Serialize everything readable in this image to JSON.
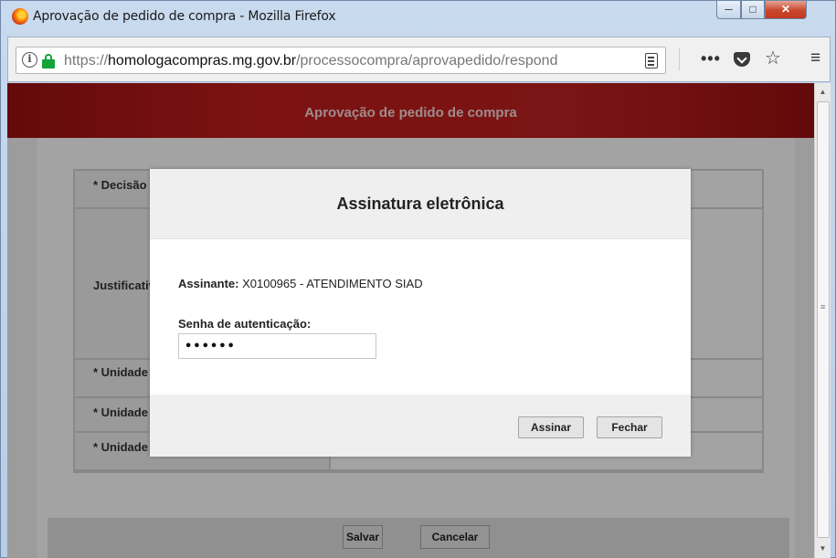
{
  "window": {
    "title": "Aprovação de pedido de compra - Mozilla Firefox",
    "minimize": "─",
    "maximize": "□",
    "close": "✕"
  },
  "nav": {
    "url_scheme": "https://",
    "url_host": "homologacompras.mg.gov.br",
    "url_path": "/processocompra/aprovapedido/respond",
    "more": "•••",
    "star": "☆",
    "menu": "≡",
    "info": "i"
  },
  "page": {
    "banner_title": "Aprovação de pedido de compra",
    "form_labels": [
      "* Decisão",
      "Justificativa",
      "* Unidade de execução",
      "* Unidade",
      "* Unidade"
    ],
    "save_label": "Salvar",
    "cancel_label": "Cancelar"
  },
  "modal": {
    "title": "Assinatura eletrônica",
    "signer_label": "Assinante:",
    "signer_value": "X0100965 - ATENDIMENTO SIAD",
    "password_label": "Senha de autenticação:",
    "password_value": "••••••",
    "sign_button": "Assinar",
    "close_button": "Fechar"
  },
  "scrollbar": {
    "up": "▲",
    "down": "▼",
    "grip": "≡"
  }
}
